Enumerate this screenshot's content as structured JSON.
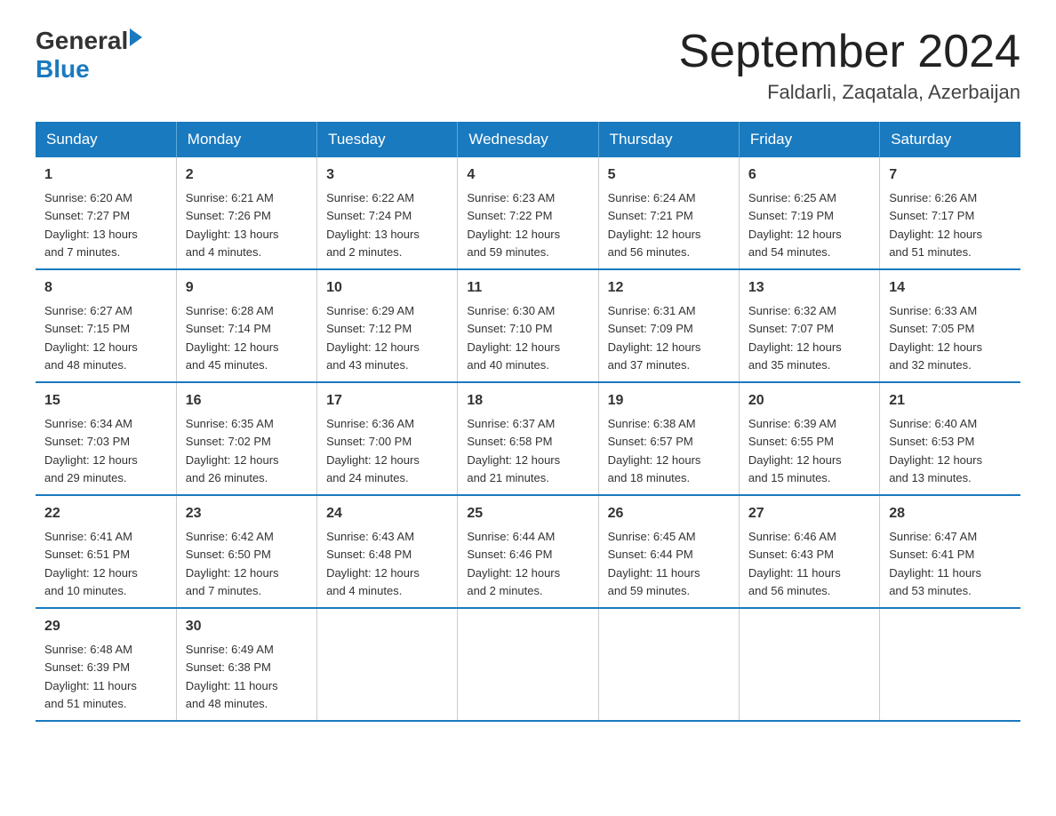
{
  "logo": {
    "text_general": "General",
    "triangle": "",
    "text_blue": "Blue"
  },
  "title": "September 2024",
  "location": "Faldarli, Zaqatala, Azerbaijan",
  "header_days": [
    "Sunday",
    "Monday",
    "Tuesday",
    "Wednesday",
    "Thursday",
    "Friday",
    "Saturday"
  ],
  "weeks": [
    [
      {
        "day": "1",
        "info": "Sunrise: 6:20 AM\nSunset: 7:27 PM\nDaylight: 13 hours\nand 7 minutes."
      },
      {
        "day": "2",
        "info": "Sunrise: 6:21 AM\nSunset: 7:26 PM\nDaylight: 13 hours\nand 4 minutes."
      },
      {
        "day": "3",
        "info": "Sunrise: 6:22 AM\nSunset: 7:24 PM\nDaylight: 13 hours\nand 2 minutes."
      },
      {
        "day": "4",
        "info": "Sunrise: 6:23 AM\nSunset: 7:22 PM\nDaylight: 12 hours\nand 59 minutes."
      },
      {
        "day": "5",
        "info": "Sunrise: 6:24 AM\nSunset: 7:21 PM\nDaylight: 12 hours\nand 56 minutes."
      },
      {
        "day": "6",
        "info": "Sunrise: 6:25 AM\nSunset: 7:19 PM\nDaylight: 12 hours\nand 54 minutes."
      },
      {
        "day": "7",
        "info": "Sunrise: 6:26 AM\nSunset: 7:17 PM\nDaylight: 12 hours\nand 51 minutes."
      }
    ],
    [
      {
        "day": "8",
        "info": "Sunrise: 6:27 AM\nSunset: 7:15 PM\nDaylight: 12 hours\nand 48 minutes."
      },
      {
        "day": "9",
        "info": "Sunrise: 6:28 AM\nSunset: 7:14 PM\nDaylight: 12 hours\nand 45 minutes."
      },
      {
        "day": "10",
        "info": "Sunrise: 6:29 AM\nSunset: 7:12 PM\nDaylight: 12 hours\nand 43 minutes."
      },
      {
        "day": "11",
        "info": "Sunrise: 6:30 AM\nSunset: 7:10 PM\nDaylight: 12 hours\nand 40 minutes."
      },
      {
        "day": "12",
        "info": "Sunrise: 6:31 AM\nSunset: 7:09 PM\nDaylight: 12 hours\nand 37 minutes."
      },
      {
        "day": "13",
        "info": "Sunrise: 6:32 AM\nSunset: 7:07 PM\nDaylight: 12 hours\nand 35 minutes."
      },
      {
        "day": "14",
        "info": "Sunrise: 6:33 AM\nSunset: 7:05 PM\nDaylight: 12 hours\nand 32 minutes."
      }
    ],
    [
      {
        "day": "15",
        "info": "Sunrise: 6:34 AM\nSunset: 7:03 PM\nDaylight: 12 hours\nand 29 minutes."
      },
      {
        "day": "16",
        "info": "Sunrise: 6:35 AM\nSunset: 7:02 PM\nDaylight: 12 hours\nand 26 minutes."
      },
      {
        "day": "17",
        "info": "Sunrise: 6:36 AM\nSunset: 7:00 PM\nDaylight: 12 hours\nand 24 minutes."
      },
      {
        "day": "18",
        "info": "Sunrise: 6:37 AM\nSunset: 6:58 PM\nDaylight: 12 hours\nand 21 minutes."
      },
      {
        "day": "19",
        "info": "Sunrise: 6:38 AM\nSunset: 6:57 PM\nDaylight: 12 hours\nand 18 minutes."
      },
      {
        "day": "20",
        "info": "Sunrise: 6:39 AM\nSunset: 6:55 PM\nDaylight: 12 hours\nand 15 minutes."
      },
      {
        "day": "21",
        "info": "Sunrise: 6:40 AM\nSunset: 6:53 PM\nDaylight: 12 hours\nand 13 minutes."
      }
    ],
    [
      {
        "day": "22",
        "info": "Sunrise: 6:41 AM\nSunset: 6:51 PM\nDaylight: 12 hours\nand 10 minutes."
      },
      {
        "day": "23",
        "info": "Sunrise: 6:42 AM\nSunset: 6:50 PM\nDaylight: 12 hours\nand 7 minutes."
      },
      {
        "day": "24",
        "info": "Sunrise: 6:43 AM\nSunset: 6:48 PM\nDaylight: 12 hours\nand 4 minutes."
      },
      {
        "day": "25",
        "info": "Sunrise: 6:44 AM\nSunset: 6:46 PM\nDaylight: 12 hours\nand 2 minutes."
      },
      {
        "day": "26",
        "info": "Sunrise: 6:45 AM\nSunset: 6:44 PM\nDaylight: 11 hours\nand 59 minutes."
      },
      {
        "day": "27",
        "info": "Sunrise: 6:46 AM\nSunset: 6:43 PM\nDaylight: 11 hours\nand 56 minutes."
      },
      {
        "day": "28",
        "info": "Sunrise: 6:47 AM\nSunset: 6:41 PM\nDaylight: 11 hours\nand 53 minutes."
      }
    ],
    [
      {
        "day": "29",
        "info": "Sunrise: 6:48 AM\nSunset: 6:39 PM\nDaylight: 11 hours\nand 51 minutes."
      },
      {
        "day": "30",
        "info": "Sunrise: 6:49 AM\nSunset: 6:38 PM\nDaylight: 11 hours\nand 48 minutes."
      },
      {
        "day": "",
        "info": ""
      },
      {
        "day": "",
        "info": ""
      },
      {
        "day": "",
        "info": ""
      },
      {
        "day": "",
        "info": ""
      },
      {
        "day": "",
        "info": ""
      }
    ]
  ]
}
